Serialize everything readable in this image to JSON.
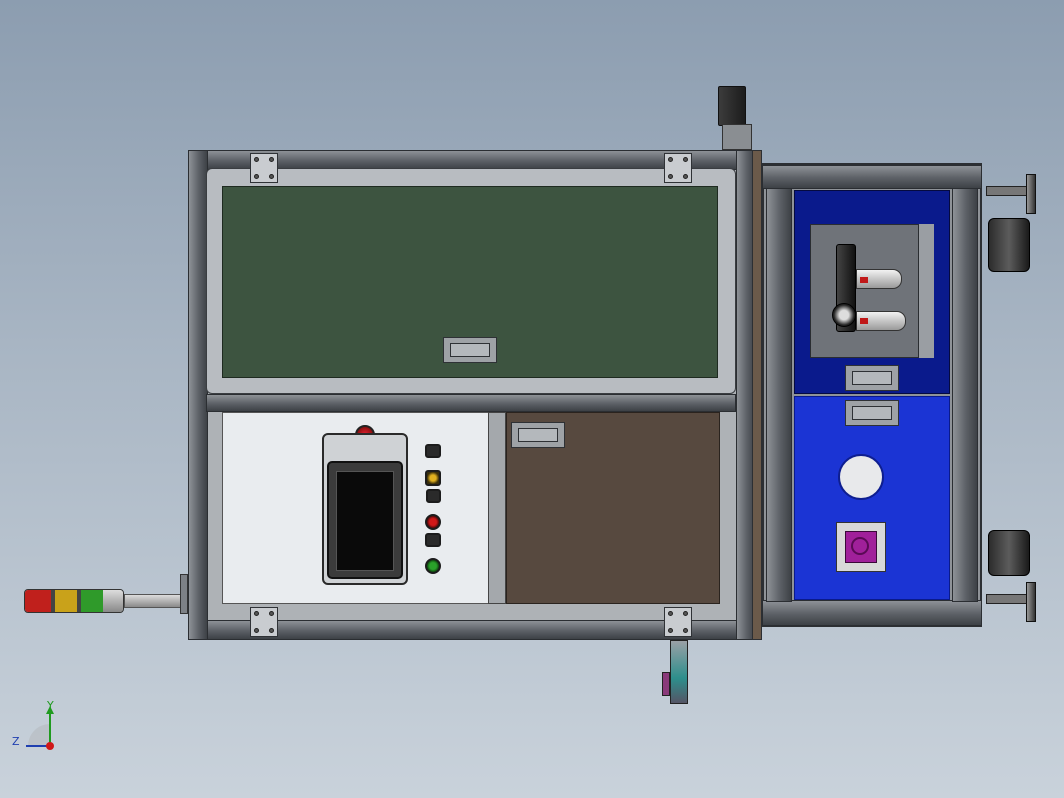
{
  "view": {
    "background_top": "#8c9db0",
    "background_bottom": "#c9d2db",
    "triad": {
      "y_label": "Y",
      "z_label": "Z"
    }
  },
  "colors": {
    "upper_panel": "#3d5440",
    "lower_right_panel": "#57493f",
    "hmi_panel_bg": "#e9ecef",
    "side_top_panel": "#0a1a8c",
    "side_bottom_panel": "#1b34d4",
    "frame_dark": "#3d4146",
    "stack_light_red": "#c0201c",
    "stack_light_amber": "#c9a21a",
    "stack_light_green": "#2f9a2a",
    "pilot_red": "#d01818",
    "pilot_amber": "#e0b020",
    "pilot_green": "#2aa12a",
    "filter_magenta": "#a0209a"
  },
  "icons": {
    "stack_light": "signal-tower-icon",
    "emergency_stop": "emergency-stop-icon",
    "caster": "caster-wheel-icon",
    "leveling_foot": "leveling-foot-icon",
    "servo_motor": "servo-motor-icon",
    "air_regulator": "frl-unit-icon",
    "fan_filter": "fan-filter-icon",
    "triad": "coordinate-triad-icon"
  }
}
